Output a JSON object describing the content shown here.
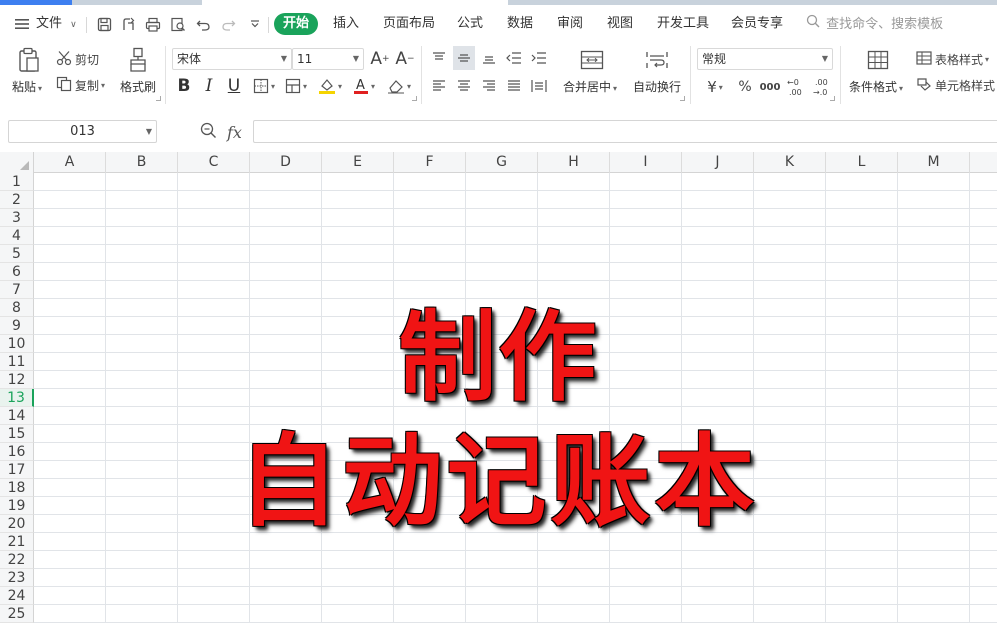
{
  "menu": {
    "file_label": "文件",
    "tabs": [
      "开始",
      "插入",
      "页面布局",
      "公式",
      "数据",
      "审阅",
      "视图",
      "开发工具",
      "会员专享"
    ],
    "active_tab": "开始",
    "search_placeholder": "查找命令、搜索模板"
  },
  "ribbon": {
    "paste": "粘贴",
    "cut": "剪切",
    "copy": "复制",
    "format_painter": "格式刷",
    "font_name": "宋体",
    "font_size": "11",
    "bold": "B",
    "italic": "I",
    "underline": "U",
    "merge_center": "合并居中",
    "wrap_text": "自动换行",
    "number_format": "常规",
    "currency": "¥",
    "percent": "%",
    "thousands": "000",
    "inc_decimal": "←0\n.00",
    "dec_decimal": ".00\n→.0",
    "conditional_format": "条件格式",
    "table_style": "表格样式",
    "cell_style": "单元格样式"
  },
  "formula_bar": {
    "name_box": "013",
    "fx_label": "fx",
    "formula_value": ""
  },
  "sheet": {
    "columns": [
      "A",
      "B",
      "C",
      "D",
      "E",
      "F",
      "G",
      "H",
      "I",
      "J",
      "K",
      "L",
      "M"
    ],
    "rows": [
      "1",
      "2",
      "3",
      "4",
      "5",
      "6",
      "7",
      "8",
      "9",
      "10",
      "11",
      "12",
      "13",
      "14",
      "15",
      "16",
      "17",
      "18",
      "19",
      "20",
      "21",
      "22",
      "23",
      "24",
      "25"
    ],
    "active_row": "13"
  },
  "overlay": {
    "line1": "制作",
    "line2": "自动记账本"
  },
  "colors": {
    "accent_green": "#1aa35b",
    "overlay_red": "#f01414"
  }
}
